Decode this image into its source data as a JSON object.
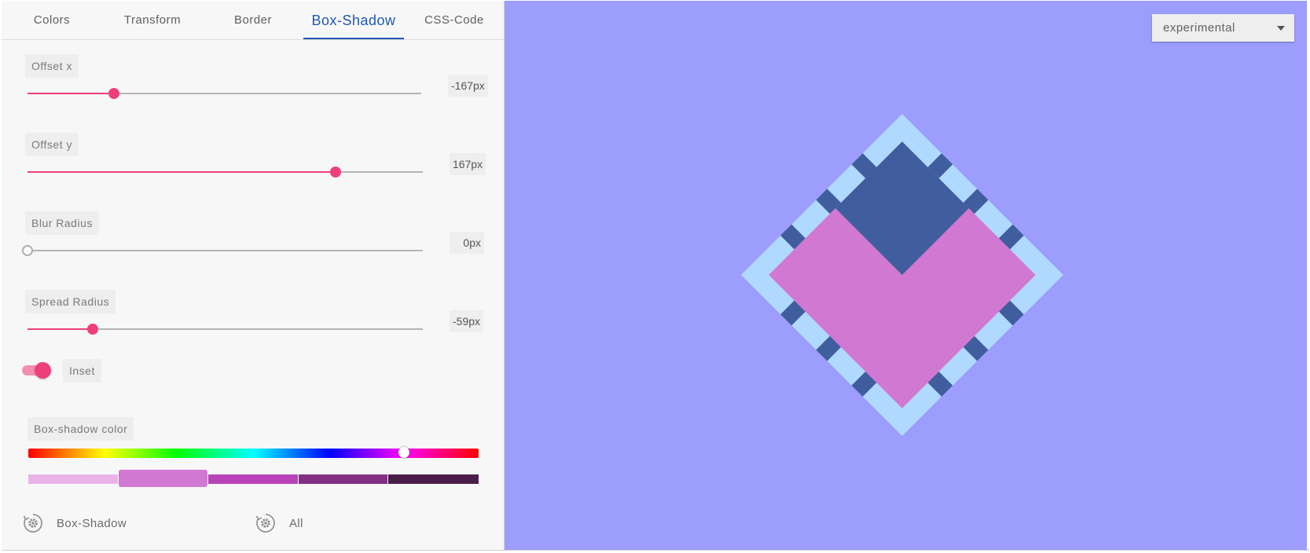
{
  "tabs": [
    {
      "label": "Colors",
      "active": false
    },
    {
      "label": "Transform",
      "active": false
    },
    {
      "label": "Border",
      "active": false
    },
    {
      "label": "Box-Shadow",
      "active": true
    },
    {
      "label": "CSS-Code",
      "active": false
    }
  ],
  "sliders": {
    "offset_x": {
      "label": "Offset x",
      "value_text": "-167px",
      "fraction": 0.22
    },
    "offset_y": {
      "label": "Offset y",
      "value_text": "167px",
      "fraction": 0.78
    },
    "blur_radius": {
      "label": "Blur Radius",
      "value_text": "0px",
      "fraction": 0.0
    },
    "spread_radius": {
      "label": "Spread Radius",
      "value_text": "-59px",
      "fraction": 0.165
    }
  },
  "inset_toggle": {
    "label": "Inset",
    "on": true
  },
  "box_shadow_color": {
    "label": "Box-shadow color",
    "hue_fraction": 0.835,
    "shades": [
      "#e9b3e7",
      "#d178d2",
      "#b843b9",
      "#832f84",
      "#4a1d4b"
    ],
    "selected_shade": 1
  },
  "reset_buttons": {
    "box_shadow": {
      "label": "Box-Shadow",
      "icon": "settings-reset-icon"
    },
    "all": {
      "label": "All",
      "icon": "settings-reset-icon"
    }
  },
  "preview": {
    "select_value": "experimental",
    "colors": {
      "background": "#9d9dfd",
      "box_fill": "#d178d2",
      "shadow_color": "#405d9d",
      "border_light": "#b0d9ff",
      "border_dark": "#405d9d"
    }
  },
  "theme": {
    "accent": "#ef3f7a",
    "tab_active": "#1f58b5"
  }
}
